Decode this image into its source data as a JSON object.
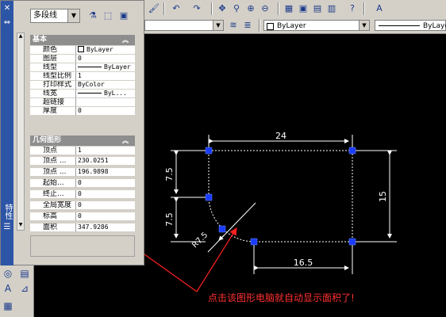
{
  "toolbar_top": {
    "icons": [
      "pan-icon",
      "zoom-realtime-icon",
      "zoom-window-icon",
      "zoom-previous-icon",
      "properties-icon",
      "design-center-icon",
      "tool-palettes-icon",
      "help-icon",
      "text-style-icon"
    ],
    "layer_combo": "",
    "color_combo": "ByLayer",
    "linetype_combo": "ByLayer"
  },
  "palette": {
    "vertical_title": "特性",
    "object_type": "多段线",
    "sections": {
      "general": {
        "title": "基本",
        "rows": [
          {
            "label": "颜色",
            "value": "ByLayer"
          },
          {
            "label": "图层",
            "value": "0"
          },
          {
            "label": "线型",
            "value": "ByLayer"
          },
          {
            "label": "线型比例",
            "value": "1"
          },
          {
            "label": "打印样式",
            "value": "ByColor"
          },
          {
            "label": "线宽",
            "value": "ByL..."
          },
          {
            "label": "超链接",
            "value": ""
          },
          {
            "label": "厚度",
            "value": "0"
          }
        ]
      },
      "geometry": {
        "title": "几何图形",
        "rows": [
          {
            "label": "顶点",
            "value": "1"
          },
          {
            "label": "顶点 ...",
            "value": "230.0251"
          },
          {
            "label": "顶点 ...",
            "value": "196.9898"
          },
          {
            "label": "起始...",
            "value": "0"
          },
          {
            "label": "终止...",
            "value": "0"
          },
          {
            "label": "全局宽度",
            "value": "0"
          },
          {
            "label": "标高",
            "value": "0"
          },
          {
            "label": "面积",
            "value": "347.9286"
          }
        ]
      }
    }
  },
  "drawing": {
    "dimensions": {
      "top": "24",
      "right": "15",
      "left_upper": "7.5",
      "left_lower": "7.5",
      "bottom": "16.5",
      "radius": "R7.5"
    },
    "annotation": "点击该图形电脑就自动显示面积了!",
    "colors": {
      "background": "#000000",
      "geometry": "#ffffff",
      "grip": "#1a3cff",
      "arrow": "#ff2020",
      "annotation": "#ff3030"
    }
  }
}
